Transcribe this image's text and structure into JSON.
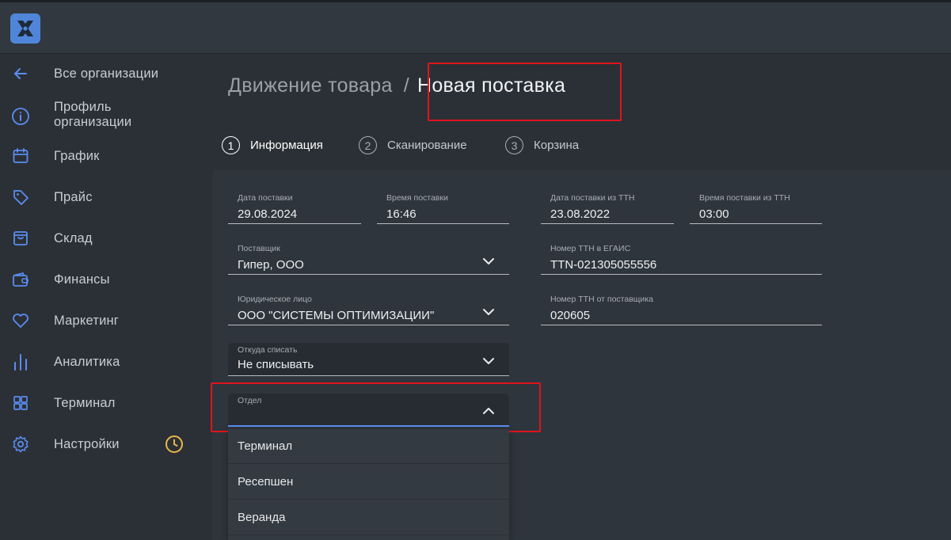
{
  "sidebar": {
    "items": [
      {
        "label": "Все организации",
        "icon": "arrow-left-icon"
      },
      {
        "label": "Профиль организации",
        "icon": "info-icon"
      },
      {
        "label": "График",
        "icon": "calendar-icon"
      },
      {
        "label": "Прайс",
        "icon": "tag-icon"
      },
      {
        "label": "Склад",
        "icon": "box-icon"
      },
      {
        "label": "Финансы",
        "icon": "wallet-icon"
      },
      {
        "label": "Маркетинг",
        "icon": "heart-icon"
      },
      {
        "label": "Аналитика",
        "icon": "bar-chart-icon"
      },
      {
        "label": "Терминал",
        "icon": "grid-icon"
      },
      {
        "label": "Настройки",
        "icon": "gear-icon"
      }
    ]
  },
  "breadcrumb": {
    "parent": "Движение товара",
    "separator": "/",
    "current": "Новая поставка"
  },
  "steps": [
    {
      "number": "1",
      "label": "Информация",
      "active": true
    },
    {
      "number": "2",
      "label": "Сканирование",
      "active": false
    },
    {
      "number": "3",
      "label": "Корзина",
      "active": false
    }
  ],
  "form": {
    "delivery_date": {
      "label": "Дата поставки",
      "value": "29.08.2024"
    },
    "delivery_time": {
      "label": "Время поставки",
      "value": "16:46"
    },
    "ttn_date": {
      "label": "Дата поставки из ТТН",
      "value": "23.08.2022"
    },
    "ttn_time": {
      "label": "Время поставки из ТТН",
      "value": "03:00"
    },
    "supplier": {
      "label": "Поставщик",
      "value": "Гипер, ООО"
    },
    "egais_ttn": {
      "label": "Номер ТТН в ЕГАИС",
      "value": "TTN-021305055556"
    },
    "legal_entity": {
      "label": "Юридическое лицо",
      "value": "ООО \"СИСТЕМЫ ОПТИМИЗАЦИИ\""
    },
    "supplier_ttn": {
      "label": "Номер ТТН от поставщика",
      "value": "020605"
    },
    "write_off_from": {
      "label": "Откуда списать",
      "value": "Не списывать"
    },
    "department": {
      "label": "Отдел",
      "value": ""
    }
  },
  "department_options": [
    "Терминал",
    "Ресепшен",
    "Веранда"
  ],
  "colors": {
    "accent": "#5b8def",
    "highlight": "#e0141e",
    "clock": "#e8b84a",
    "logo": "#4f86d9"
  }
}
